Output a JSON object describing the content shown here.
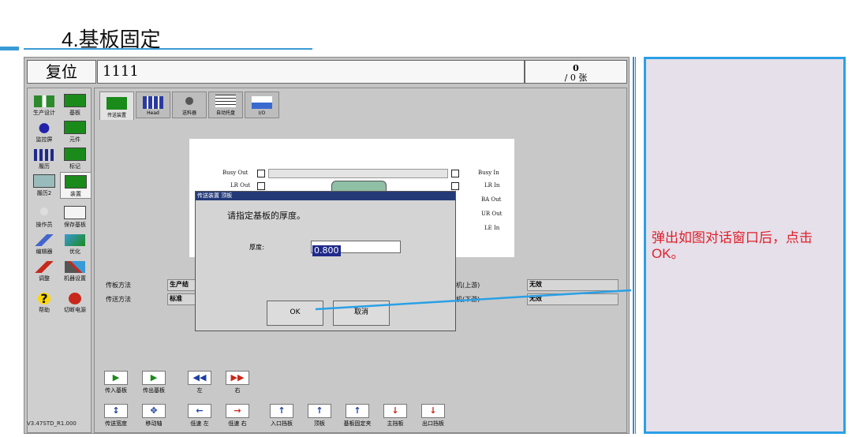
{
  "slide": {
    "title": "4.基板固定"
  },
  "app": {
    "reset_label": "复位",
    "job_name": "1111",
    "counter_top": "0",
    "counter_bottom": "/ 0 张",
    "version": "V3.47STD_R1.000",
    "side_buttons": [
      "生产设计",
      "基板",
      "监控屏",
      "元件",
      "履历",
      "标记",
      "履历2",
      "装置",
      "操作员",
      "保存基板",
      "编辑器",
      "优化",
      "调整",
      "机器设置",
      "帮助",
      "切断电源"
    ],
    "tabs": [
      "传送装置",
      "Head",
      "送料器",
      "自动托盘",
      "I/O"
    ],
    "signals_left": [
      "Busy Out",
      "LR Out"
    ],
    "signals_right": [
      "Busy In",
      "LR In",
      "BA Out",
      "UR Out",
      "LE In"
    ],
    "params": {
      "transfer_method_label": "传板方法",
      "transfer_method_value": "生产结",
      "convey_method_label": "传送方法",
      "convey_method_value": "标准",
      "upstream_label": "机(上游)",
      "upstream_value": "无效",
      "downstream_label": "机(下游)",
      "downstream_value": "无效"
    },
    "ops_row1": [
      "传入基板",
      "传出基板",
      "左",
      "右"
    ],
    "ops_row2": [
      "传送宽度",
      "移动轴",
      "低速 左",
      "低速 右",
      "入口挡板",
      "顶板",
      "基板固定夹",
      "主挡板",
      "出口挡板"
    ]
  },
  "dialog": {
    "title": "传送装置 顶板",
    "message": "请指定基板的厚度。",
    "thickness_label": "厚度:",
    "thickness_value": "0.800",
    "ok_label": "OK",
    "cancel_label": "取消"
  },
  "note": "弹出如图对话窗口后，点击OK。",
  "colors": {
    "accent": "#2aa0e6",
    "note": "#e0202a",
    "dialog_title": "#243a78"
  }
}
